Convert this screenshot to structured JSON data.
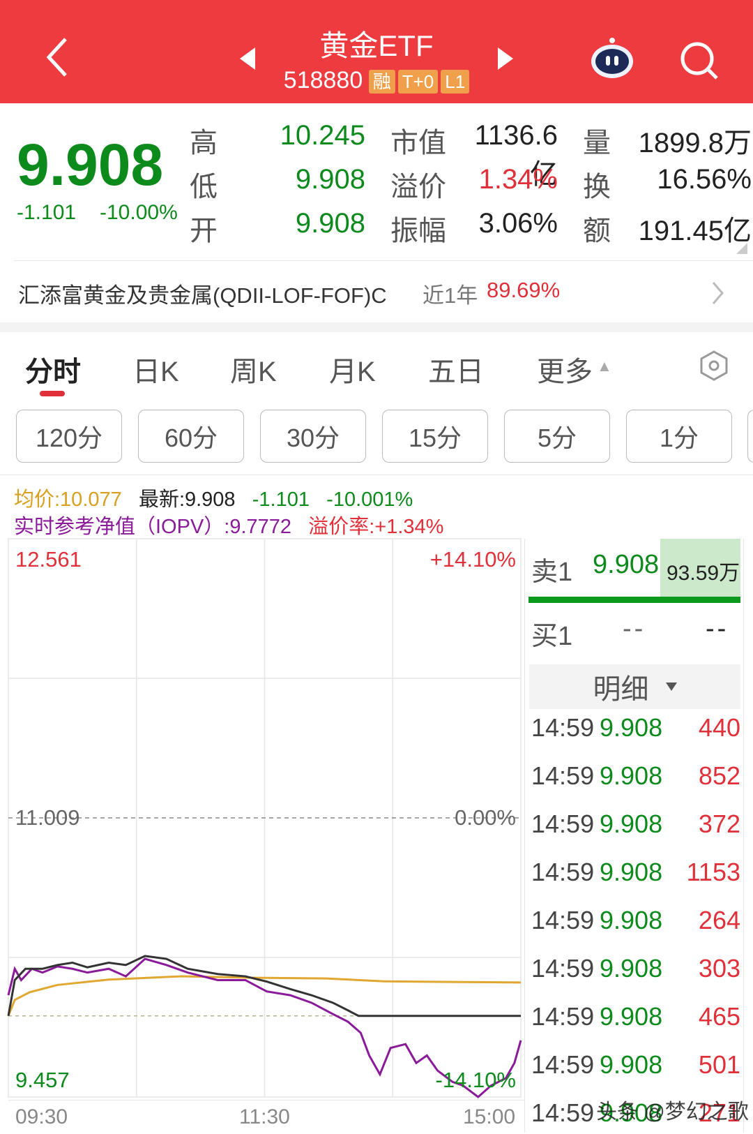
{
  "header": {
    "title": "黄金ETF",
    "code": "518880",
    "badges": [
      "融",
      "T+0",
      "L1"
    ]
  },
  "quote": {
    "price": "9.908",
    "change": "-1.101",
    "change_pct": "-10.00%",
    "stats": [
      {
        "label": "高",
        "value": "10.245",
        "color": "green"
      },
      {
        "label": "低",
        "value": "9.908",
        "color": "green"
      },
      {
        "label": "开",
        "value": "9.908",
        "color": "green"
      },
      {
        "label": "市值",
        "value": "1136.6亿",
        "color": "dark"
      },
      {
        "label": "溢价",
        "value": "1.34%",
        "color": "red"
      },
      {
        "label": "振幅",
        "value": "3.06%",
        "color": "dark"
      },
      {
        "label": "量",
        "value": "1899.8万",
        "color": "dark"
      },
      {
        "label": "换",
        "value": "16.56%",
        "color": "dark"
      },
      {
        "label": "额",
        "value": "191.45亿",
        "color": "dark"
      }
    ]
  },
  "fund": {
    "name": "汇添富黄金及贵金属(QDII-LOF-FOF)C",
    "period": "近1年",
    "return": "89.69%"
  },
  "tabs": [
    "分时",
    "日K",
    "周K",
    "月K",
    "五日",
    "更多"
  ],
  "periods": [
    "120分",
    "60分",
    "30分",
    "15分",
    "5分",
    "1分"
  ],
  "info": {
    "avg": "均价:10.077",
    "latest": "最新:9.908",
    "change": "-1.101",
    "change_pct": "-10.001%",
    "iopv": "实时参考净值（IOPV）:9.7772",
    "premium": "溢价率:+1.34%"
  },
  "orderbook": {
    "sell1": {
      "label": "卖1",
      "price": "9.908",
      "volume": "93.59万"
    },
    "buy1": {
      "label": "买1",
      "price": "--",
      "volume": "--"
    },
    "detail_label": "明细"
  },
  "trades": [
    {
      "time": "14:59",
      "price": "9.908",
      "volume": "440"
    },
    {
      "time": "14:59",
      "price": "9.908",
      "volume": "852"
    },
    {
      "time": "14:59",
      "price": "9.908",
      "volume": "372"
    },
    {
      "time": "14:59",
      "price": "9.908",
      "volume": "1153"
    },
    {
      "time": "14:59",
      "price": "9.908",
      "volume": "264"
    },
    {
      "time": "14:59",
      "price": "9.908",
      "volume": "303"
    },
    {
      "time": "14:59",
      "price": "9.908",
      "volume": "465"
    },
    {
      "time": "14:59",
      "price": "9.908",
      "volume": "501"
    },
    {
      "time": "14:59",
      "price": "9.908",
      "volume": "271"
    }
  ],
  "watermark": "头条 @梦幻之歌",
  "chart_data": {
    "type": "line",
    "title": "分时",
    "y_left_ticks": [
      "12.561",
      "11.009",
      "9.457"
    ],
    "y_right_ticks": [
      "+14.10%",
      "0.00%",
      "-14.10%"
    ],
    "x_ticks": [
      "09:30",
      "11:30",
      "15:00"
    ],
    "ylim": [
      9.457,
      12.561
    ],
    "prev_close": 11.009,
    "x_unit": "minutes since open (0-240)",
    "series": [
      {
        "name": "最新",
        "color": "#333333",
        "x": [
          0,
          3,
          8,
          16,
          23,
          30,
          37,
          47,
          55,
          64,
          74,
          84,
          98,
          111,
          121,
          132,
          142,
          152,
          159,
          164,
          240
        ],
        "y": [
          9.908,
          10.107,
          10.17,
          10.17,
          10.191,
          10.204,
          10.178,
          10.204,
          10.191,
          10.241,
          10.225,
          10.17,
          10.141,
          10.128,
          10.099,
          10.057,
          10.023,
          9.981,
          9.939,
          9.908,
          9.908
        ]
      },
      {
        "name": "IOPV",
        "color": "#8a1a9a",
        "x": [
          0,
          3,
          6,
          11,
          16,
          23,
          30,
          37,
          47,
          55,
          64,
          74,
          84,
          98,
          111,
          121,
          132,
          142,
          152,
          159,
          165,
          169,
          174,
          179,
          186,
          191,
          196,
          201,
          208,
          213,
          220,
          226,
          233,
          237,
          240
        ],
        "y": [
          10.023,
          10.17,
          10.107,
          10.17,
          10.149,
          10.183,
          10.17,
          10.149,
          10.17,
          10.128,
          10.225,
          10.191,
          10.149,
          10.107,
          10.107,
          10.044,
          10.023,
          9.981,
          9.918,
          9.876,
          9.814,
          9.688,
          9.583,
          9.73,
          9.751,
          9.646,
          9.688,
          9.604,
          9.541,
          9.52,
          9.457,
          9.52,
          9.562,
          9.646,
          9.772
        ]
      },
      {
        "name": "均价",
        "color": "#e0a830",
        "x": [
          0,
          3,
          10,
          23,
          47,
          81,
          115,
          149,
          176,
          240
        ],
        "y": [
          9.908,
          9.997,
          10.04,
          10.08,
          10.11,
          10.128,
          10.12,
          10.116,
          10.1,
          10.094
        ]
      }
    ]
  }
}
